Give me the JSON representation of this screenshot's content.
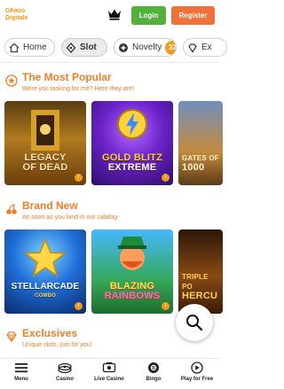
{
  "header": {
    "logo_line1": "Ghaoo",
    "logo_line2": "Digitale",
    "login_label": "Login",
    "register_label": "Register",
    "colors": {
      "login": "#52b13a",
      "register": "#f2703a",
      "brand": "#f29a1c"
    }
  },
  "tabs": [
    {
      "label": "Home",
      "icon": "home-icon"
    },
    {
      "label": "Slot",
      "icon": "slot-icon",
      "active": true
    },
    {
      "label": "Novelty",
      "icon": "novelty-icon",
      "badge": "32"
    },
    {
      "label": "Ex",
      "icon": "exclusive-icon"
    }
  ],
  "sections": {
    "popular": {
      "title": "The Most Popular",
      "subtitle": "Were you looking for me? Here they are!",
      "icon": "star-circle-icon",
      "games": [
        {
          "title_line1": "LEGACY",
          "title_line2": "OF DEAD"
        },
        {
          "title_line1": "GOLD BLITZ",
          "title_line2": "EXTREME"
        },
        {
          "title_line1": "GATES OF",
          "title_line2": "1000"
        }
      ]
    },
    "new": {
      "title": "Brand New",
      "subtitle": "As soon as you land in our catalog",
      "icon": "cherries-icon",
      "games": [
        {
          "title_line1": "STELLARCADE",
          "title_line2": "COMBO"
        },
        {
          "title_line1": "BLAZING",
          "title_line2": "RAINBOWS"
        },
        {
          "title_line1": "TRIPLE PO",
          "title_line2": "HERCU"
        }
      ]
    },
    "exclusives": {
      "title": "Exclusives",
      "subtitle": "Unique slots, just for you!",
      "icon": "diamond-icon"
    }
  },
  "bottom_nav": [
    {
      "label": "Menu",
      "icon": "menu-icon"
    },
    {
      "label": "Casino",
      "icon": "casino-icon"
    },
    {
      "label": "Live Casino",
      "icon": "live-casino-icon"
    },
    {
      "label": "Bingo",
      "icon": "bingo-icon"
    },
    {
      "label": "Play for Free",
      "icon": "play-free-icon"
    }
  ],
  "accent_color": "#f07e28"
}
